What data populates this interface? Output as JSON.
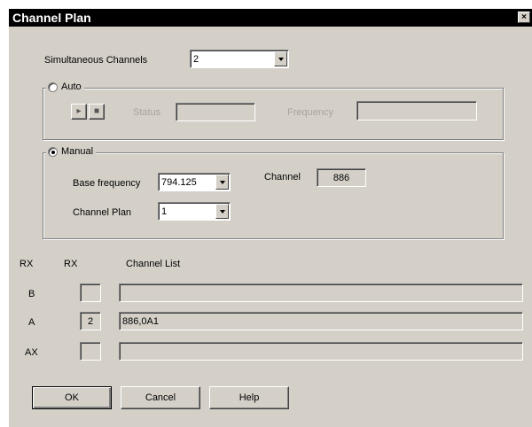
{
  "window": {
    "title": "Channel Plan",
    "close_glyph": "×"
  },
  "simultaneous": {
    "label": "Simultaneous Channels",
    "value": "2"
  },
  "auto": {
    "label": "Auto",
    "selected": false,
    "play_glyph": "▸",
    "stop_glyph": "■",
    "status_label": "Status",
    "frequency_label": "Frequency"
  },
  "manual": {
    "label": "Manual",
    "selected": true,
    "base_frequency_label": "Base frequency",
    "base_frequency_value": "794.125",
    "channel_label": "Channel",
    "channel_value": "886",
    "channel_plan_label": "Channel Plan",
    "channel_plan_value": "1"
  },
  "table": {
    "col_rx1": "RX",
    "col_rx2": "RX",
    "col_channel_list": "Channel List",
    "rows": [
      {
        "name": "B",
        "count": "",
        "channels": ""
      },
      {
        "name": "A",
        "count": "2",
        "channels": "886,0A1"
      },
      {
        "name": "AX",
        "count": "",
        "channels": ""
      }
    ]
  },
  "buttons": {
    "ok": "OK",
    "cancel": "Cancel",
    "help": "Help"
  }
}
